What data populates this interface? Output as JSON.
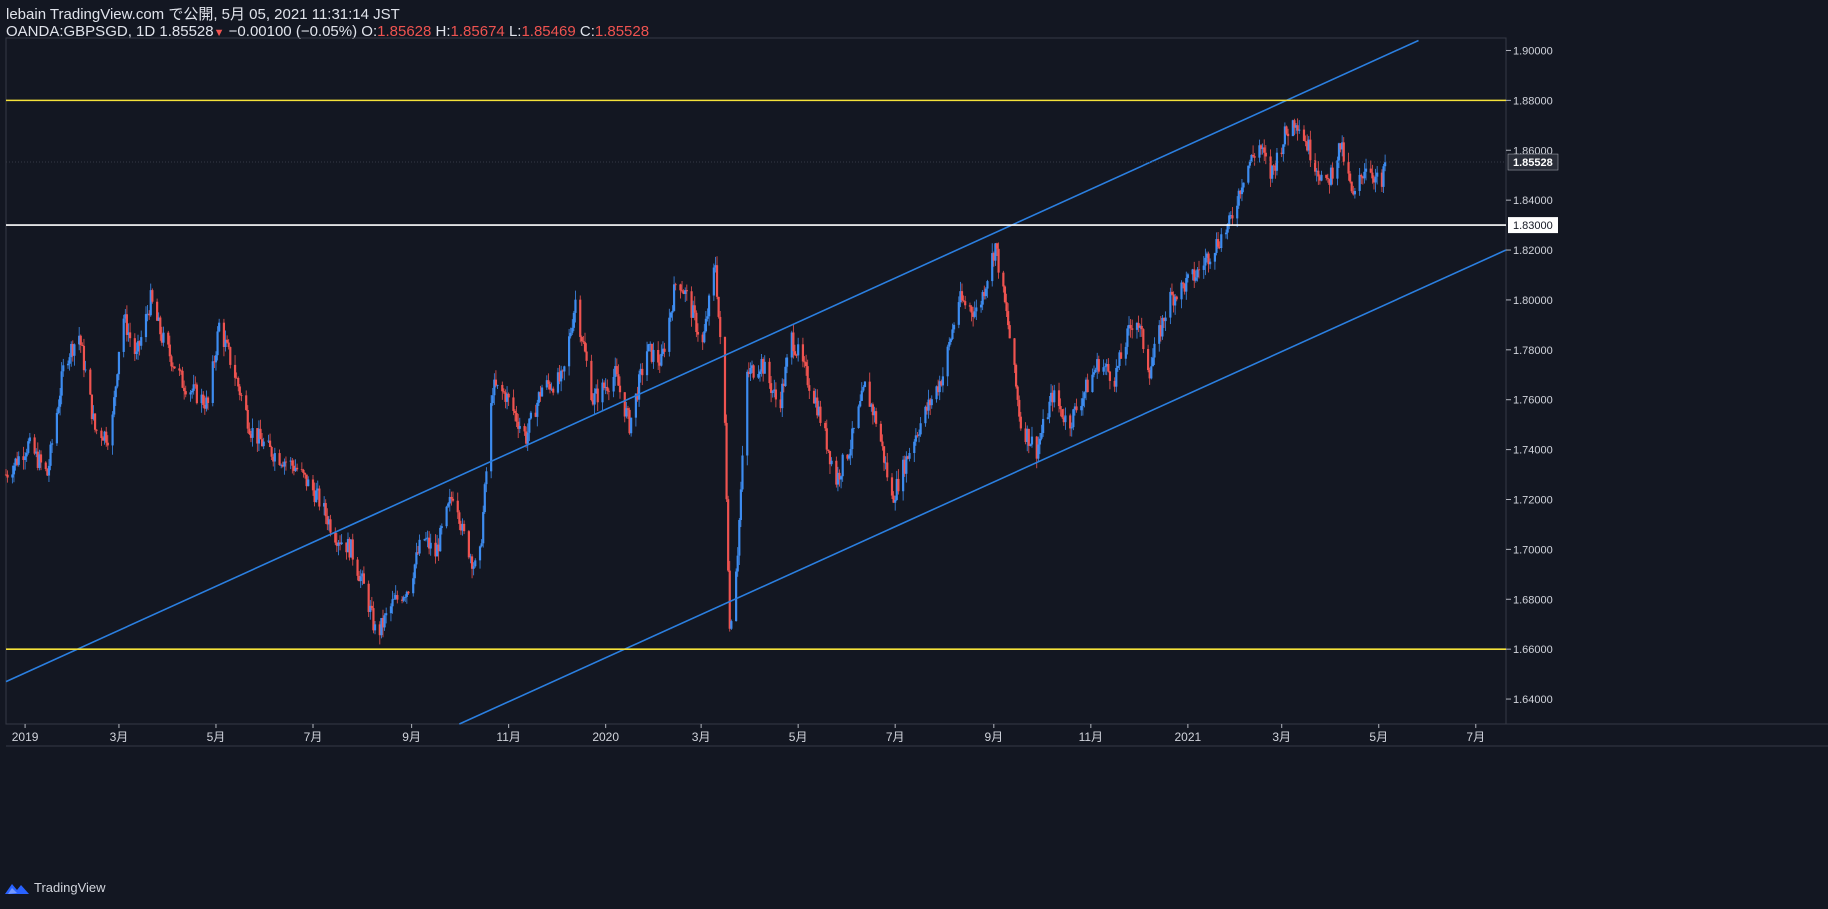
{
  "header": {
    "published_line": "lebain TradingView.com で公開, 5月 05, 2021 11:31:14 JST",
    "symbol": "OANDA:GBPSGD, 1D",
    "last": "1.85528",
    "change_arrow": "▼",
    "change": "−0.00100 (−0.05%)",
    "o_label": "O:",
    "o_value": "1.85628",
    "h_label": "H:",
    "h_value": "1.85674",
    "l_label": "L:",
    "l_value": "1.85469",
    "c_label": "C:",
    "c_value": "1.85528"
  },
  "footer": {
    "brand": "TradingView",
    "logo_icon": "tradingview-logo-icon"
  },
  "colors": {
    "background": "#131722",
    "up": "#2962ff",
    "up_light": "#3d8cf0",
    "down": "#ef5350",
    "channel": "#2b7fe0",
    "support_resistance": "#f5e23b",
    "level_white": "#ffffff",
    "axis_text": "#d1d4dc"
  },
  "chart_data": {
    "type": "candlestick",
    "symbol": "OANDA:GBPSGD",
    "interval": "1D",
    "ylim": [
      1.63,
      1.905
    ],
    "y_ticks": [
      1.64,
      1.66,
      1.68,
      1.7,
      1.72,
      1.74,
      1.76,
      1.78,
      1.8,
      1.82,
      1.84,
      1.86,
      1.88,
      1.9
    ],
    "y_tick_labels": [
      "1.64000",
      "1.66000",
      "1.68000",
      "1.70000",
      "1.72000",
      "1.74000",
      "1.76000",
      "1.78000",
      "1.80000",
      "1.82000",
      "1.84000",
      "1.86000",
      "1.88000",
      "1.90000"
    ],
    "x_range": [
      "2018-12-20",
      "2021-07-20"
    ],
    "x_ticks": [
      {
        "date": "2019-01-01",
        "label": "2019"
      },
      {
        "date": "2019-03-01",
        "label": "3月"
      },
      {
        "date": "2019-05-01",
        "label": "5月"
      },
      {
        "date": "2019-07-01",
        "label": "7月"
      },
      {
        "date": "2019-09-01",
        "label": "9月"
      },
      {
        "date": "2019-11-01",
        "label": "11月"
      },
      {
        "date": "2020-01-01",
        "label": "2020"
      },
      {
        "date": "2020-03-01",
        "label": "3月"
      },
      {
        "date": "2020-05-01",
        "label": "5月"
      },
      {
        "date": "2020-07-01",
        "label": "7月"
      },
      {
        "date": "2020-09-01",
        "label": "9月"
      },
      {
        "date": "2020-11-01",
        "label": "11月"
      },
      {
        "date": "2021-01-01",
        "label": "2021"
      },
      {
        "date": "2021-03-01",
        "label": "3月"
      },
      {
        "date": "2021-05-01",
        "label": "5月"
      },
      {
        "date": "2021-07-01",
        "label": "7月"
      }
    ],
    "horizontal_levels": [
      {
        "value": 1.88,
        "color": "#f5e23b"
      },
      {
        "value": 1.83,
        "color": "#ffffff",
        "label": "1.83000"
      },
      {
        "value": 1.66,
        "color": "#f5e23b"
      }
    ],
    "current_price": {
      "value": 1.85528,
      "label": "1.85528"
    },
    "channel_lines": [
      {
        "from": {
          "date": "2018-12-20",
          "value": 1.647
        },
        "to": {
          "date": "2021-05-26",
          "value": 1.904
        }
      },
      {
        "from": {
          "date": "2019-10-01",
          "value": 1.63
        },
        "to": {
          "date": "2021-07-20",
          "value": 1.82
        }
      }
    ],
    "price_path": [
      {
        "date": "2018-12-20",
        "close": 1.73
      },
      {
        "date": "2019-01-03",
        "close": 1.742
      },
      {
        "date": "2019-01-15",
        "close": 1.73
      },
      {
        "date": "2019-01-26",
        "close": 1.776
      },
      {
        "date": "2019-02-04",
        "close": 1.786
      },
      {
        "date": "2019-02-14",
        "close": 1.748
      },
      {
        "date": "2019-02-24",
        "close": 1.745
      },
      {
        "date": "2019-03-03",
        "close": 1.795
      },
      {
        "date": "2019-03-12",
        "close": 1.777
      },
      {
        "date": "2019-03-21",
        "close": 1.8
      },
      {
        "date": "2019-03-28",
        "close": 1.785
      },
      {
        "date": "2019-04-10",
        "close": 1.767
      },
      {
        "date": "2019-04-26",
        "close": 1.758
      },
      {
        "date": "2019-05-03",
        "close": 1.79
      },
      {
        "date": "2019-05-13",
        "close": 1.77
      },
      {
        "date": "2019-05-23",
        "close": 1.748
      },
      {
        "date": "2019-06-03",
        "close": 1.74
      },
      {
        "date": "2019-06-20",
        "close": 1.733
      },
      {
        "date": "2019-07-03",
        "close": 1.722
      },
      {
        "date": "2019-07-15",
        "close": 1.706
      },
      {
        "date": "2019-07-25",
        "close": 1.7
      },
      {
        "date": "2019-08-03",
        "close": 1.683
      },
      {
        "date": "2019-08-10",
        "close": 1.665
      },
      {
        "date": "2019-08-20",
        "close": 1.678
      },
      {
        "date": "2019-08-30",
        "close": 1.685
      },
      {
        "date": "2019-09-08",
        "close": 1.705
      },
      {
        "date": "2019-09-16",
        "close": 1.698
      },
      {
        "date": "2019-09-28",
        "close": 1.725
      },
      {
        "date": "2019-10-03",
        "close": 1.707
      },
      {
        "date": "2019-10-13",
        "close": 1.689
      },
      {
        "date": "2019-10-22",
        "close": 1.765
      },
      {
        "date": "2019-10-30",
        "close": 1.762
      },
      {
        "date": "2019-11-12",
        "close": 1.745
      },
      {
        "date": "2019-11-22",
        "close": 1.765
      },
      {
        "date": "2019-12-05",
        "close": 1.768
      },
      {
        "date": "2019-12-13",
        "close": 1.8
      },
      {
        "date": "2019-12-24",
        "close": 1.76
      },
      {
        "date": "2020-01-07",
        "close": 1.77
      },
      {
        "date": "2020-01-16",
        "close": 1.75
      },
      {
        "date": "2020-01-27",
        "close": 1.78
      },
      {
        "date": "2020-02-05",
        "close": 1.775
      },
      {
        "date": "2020-02-15",
        "close": 1.81
      },
      {
        "date": "2020-02-23",
        "close": 1.798
      },
      {
        "date": "2020-03-02",
        "close": 1.782
      },
      {
        "date": "2020-03-10",
        "close": 1.815
      },
      {
        "date": "2020-03-16",
        "close": 1.75
      },
      {
        "date": "2020-03-19",
        "close": 1.668
      },
      {
        "date": "2020-03-24",
        "close": 1.7
      },
      {
        "date": "2020-03-30",
        "close": 1.77
      },
      {
        "date": "2020-04-08",
        "close": 1.775
      },
      {
        "date": "2020-04-19",
        "close": 1.757
      },
      {
        "date": "2020-04-27",
        "close": 1.785
      },
      {
        "date": "2020-05-12",
        "close": 1.76
      },
      {
        "date": "2020-05-25",
        "close": 1.728
      },
      {
        "date": "2020-06-03",
        "close": 1.742
      },
      {
        "date": "2020-06-12",
        "close": 1.765
      },
      {
        "date": "2020-06-20",
        "close": 1.75
      },
      {
        "date": "2020-06-29",
        "close": 1.72
      },
      {
        "date": "2020-07-13",
        "close": 1.745
      },
      {
        "date": "2020-07-31",
        "close": 1.77
      },
      {
        "date": "2020-08-10",
        "close": 1.8
      },
      {
        "date": "2020-08-22",
        "close": 1.795
      },
      {
        "date": "2020-09-02",
        "close": 1.822
      },
      {
        "date": "2020-09-10",
        "close": 1.79
      },
      {
        "date": "2020-09-18",
        "close": 1.75
      },
      {
        "date": "2020-09-28",
        "close": 1.74
      },
      {
        "date": "2020-10-08",
        "close": 1.762
      },
      {
        "date": "2020-10-18",
        "close": 1.75
      },
      {
        "date": "2020-11-06",
        "close": 1.775
      },
      {
        "date": "2020-11-16",
        "close": 1.769
      },
      {
        "date": "2020-11-29",
        "close": 1.795
      },
      {
        "date": "2020-12-08",
        "close": 1.772
      },
      {
        "date": "2020-12-20",
        "close": 1.8
      },
      {
        "date": "2021-01-06",
        "close": 1.81
      },
      {
        "date": "2021-01-16",
        "close": 1.82
      },
      {
        "date": "2021-01-27",
        "close": 1.83
      },
      {
        "date": "2021-02-06",
        "close": 1.852
      },
      {
        "date": "2021-02-15",
        "close": 1.862
      },
      {
        "date": "2021-02-22",
        "close": 1.85
      },
      {
        "date": "2021-03-03",
        "close": 1.866
      },
      {
        "date": "2021-03-10",
        "close": 1.873
      },
      {
        "date": "2021-03-20",
        "close": 1.858
      },
      {
        "date": "2021-03-29",
        "close": 1.845
      },
      {
        "date": "2021-04-07",
        "close": 1.862
      },
      {
        "date": "2021-04-15",
        "close": 1.84
      },
      {
        "date": "2021-04-23",
        "close": 1.855
      },
      {
        "date": "2021-05-03",
        "close": 1.845
      },
      {
        "date": "2021-05-05",
        "close": 1.855
      }
    ]
  }
}
